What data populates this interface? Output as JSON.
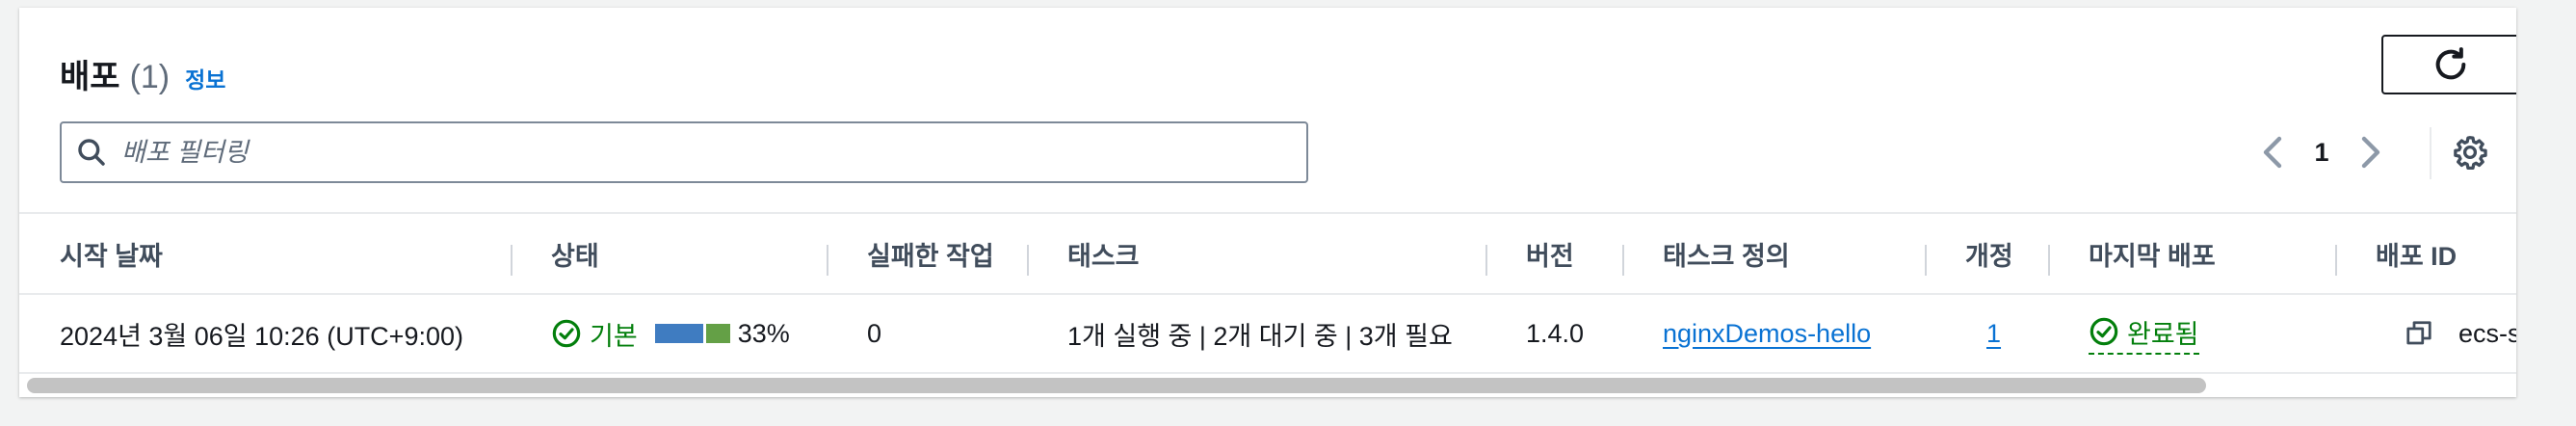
{
  "header": {
    "title": "배포",
    "count": "(1)",
    "info_link": "정보"
  },
  "search": {
    "placeholder": "배포 필터링",
    "value": ""
  },
  "pagination": {
    "current_page": "1"
  },
  "table": {
    "columns": [
      "시작 날짜",
      "상태",
      "실패한 작업",
      "태스크",
      "버전",
      "태스크 정의",
      "개정",
      "마지막 배포",
      "배포 ID"
    ],
    "rows": [
      {
        "start_date": "2024년 3월 06일 10:26 (UTC+9:00)",
        "status": "기본",
        "status_progress": 0.33,
        "status_percent": "33%",
        "failed_tasks": "0",
        "tasks": "1개 실행 중 | 2개 대기 중 | 3개 필요",
        "version": "1.4.0",
        "task_definition": "nginxDemos-hello",
        "revision": "1",
        "last_deployment": "완료됨",
        "deployment_id": "ecs-svc"
      }
    ]
  },
  "colors": {
    "link": "#0972d3",
    "success": "#037f0c",
    "progress_blue": "#3f7cc1",
    "progress_green": "#64a046"
  },
  "icons": {
    "search": "search-icon",
    "refresh": "refresh-icon",
    "prev": "chevron-left-icon",
    "next": "chevron-right-icon",
    "settings": "gear-icon",
    "status": "check-circle-icon",
    "copy": "copy-icon"
  }
}
